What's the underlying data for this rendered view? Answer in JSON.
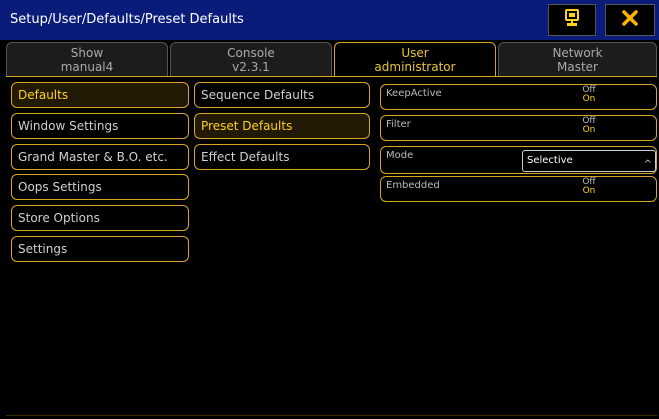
{
  "window": {
    "title": "Setup/User/Defaults/Preset Defaults"
  },
  "titlebar_buttons": [
    {
      "name": "monitor-icon",
      "glyph": "monitor"
    },
    {
      "name": "close-icon",
      "glyph": "✕"
    }
  ],
  "tabs": [
    {
      "name": "Show",
      "value": "manual4",
      "active": false
    },
    {
      "name": "Console",
      "value": "v2.3.1",
      "active": false
    },
    {
      "name": "User",
      "value": "administrator",
      "active": true
    },
    {
      "name": "Network",
      "value": "Master",
      "active": false
    }
  ],
  "col1": [
    {
      "label": "Defaults",
      "selected": true
    },
    {
      "label": "Window Settings",
      "selected": false
    },
    {
      "label": "Grand Master & B.O. etc.",
      "selected": false
    },
    {
      "label": "Oops Settings",
      "selected": false
    },
    {
      "label": "Store Options",
      "selected": false
    },
    {
      "label": "Settings",
      "selected": false
    }
  ],
  "col2": [
    {
      "label": "Sequence Defaults",
      "selected": false
    },
    {
      "label": "Preset Defaults",
      "selected": true
    },
    {
      "label": "Effect Defaults",
      "selected": false
    }
  ],
  "props": {
    "keepactive": {
      "label": "KeepActive",
      "off": "Off",
      "on": "On"
    },
    "filter": {
      "label": "Filter",
      "off": "Off",
      "on": "On"
    },
    "mode": {
      "label": "Mode",
      "value": "Selective"
    },
    "embedded": {
      "label": "Embedded",
      "off": "Off",
      "on": "On"
    }
  },
  "colors": {
    "accent": "#d9a520",
    "title_bg": "#0a1c7a",
    "selected_text": "#ffd21a"
  }
}
